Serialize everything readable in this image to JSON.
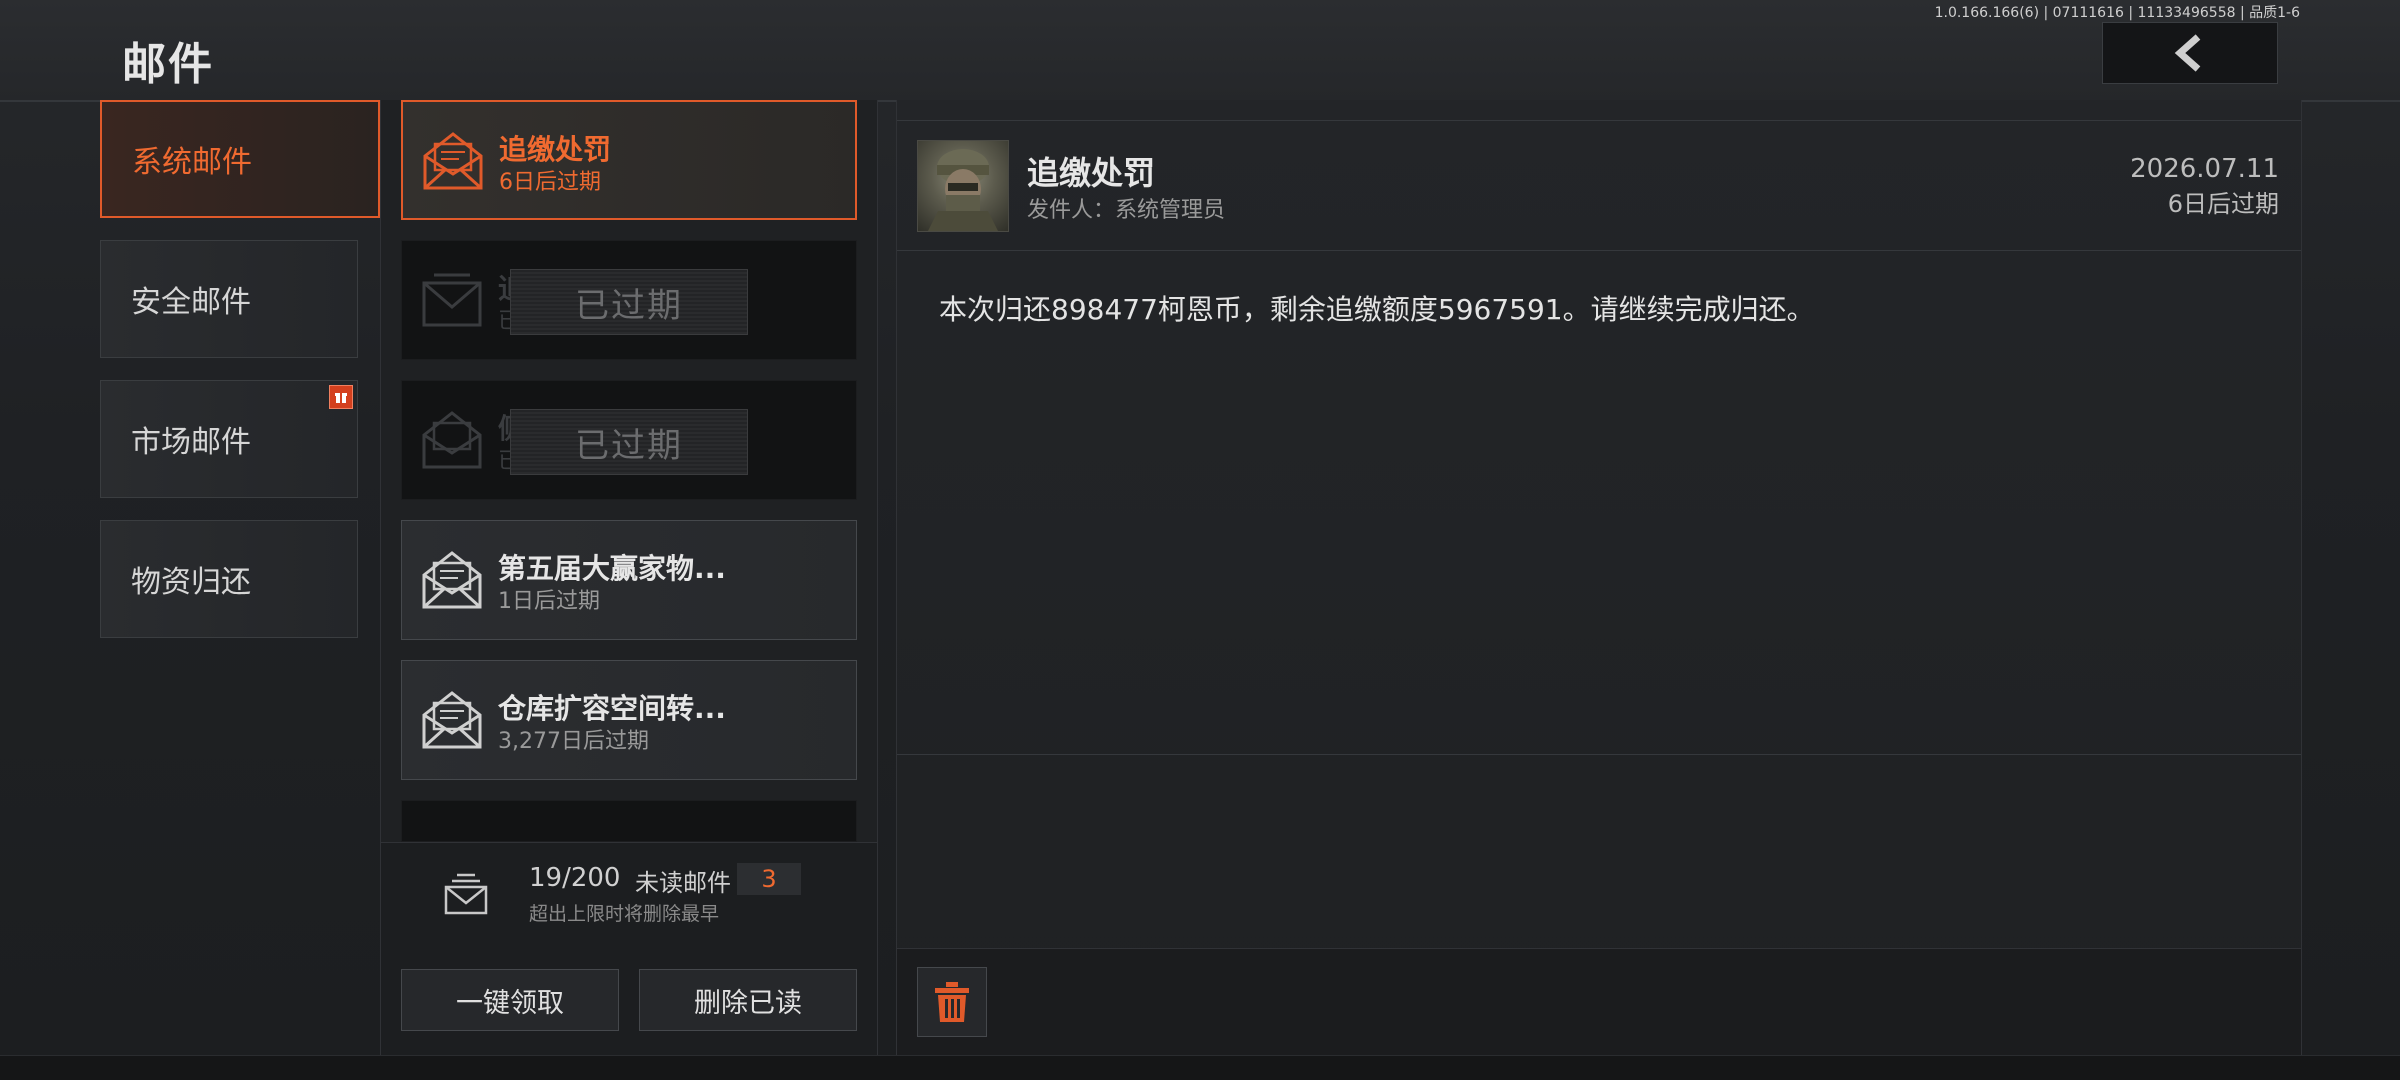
{
  "header": {
    "title": "邮件",
    "version": "1.0.166.166(6) | 07111616 | 11133496558 | 品质1-6"
  },
  "categories": [
    {
      "label": "系统邮件",
      "active": true
    },
    {
      "label": "安全邮件",
      "active": false
    },
    {
      "label": "市场邮件",
      "active": false,
      "badge": "gift-icon"
    },
    {
      "label": "物资归还",
      "active": false
    }
  ],
  "mails": [
    {
      "title": "追缴处罚",
      "sub": "6日后过期",
      "state": "active"
    },
    {
      "title": "追",
      "sub": "已",
      "state": "expired",
      "stamp": "已过期"
    },
    {
      "title": "侧",
      "sub": "已",
      "state": "expired",
      "stamp": "已过期"
    },
    {
      "title": "第五届大赢家物...",
      "sub": "1日后过期",
      "state": "normal"
    },
    {
      "title": "仓库扩容空间转...",
      "sub": "3,277日后过期",
      "state": "normal"
    }
  ],
  "footer": {
    "count": "19/200",
    "unread_label": "未读邮件",
    "unread_count": "3",
    "limit_note": "超出上限时将删除最早",
    "claim_all": "一键领取",
    "delete_read": "删除已读"
  },
  "detail": {
    "title": "追缴处罚",
    "sender": "发件人：系统管理员",
    "date": "2026.07.11",
    "expiry": "6日后过期",
    "body": "本次归还898477柯恩币，剩余追缴额度5967591。请继续完成归还。"
  },
  "colors": {
    "accent": "#e05a2a",
    "accent_text": "#f06a30",
    "background": "#202225",
    "panel": "#1f2123"
  }
}
